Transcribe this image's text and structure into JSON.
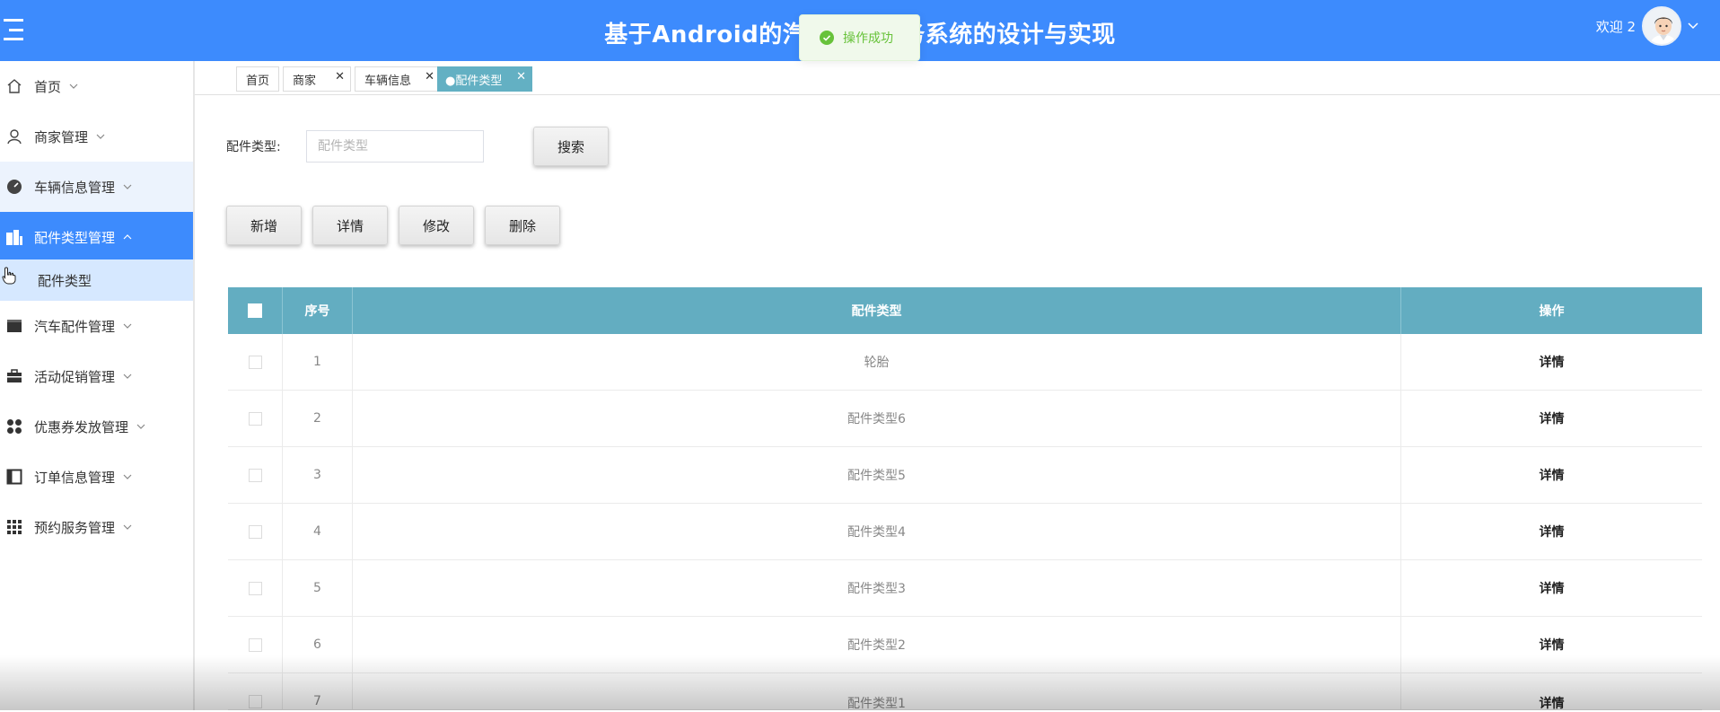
{
  "header": {
    "title": "基于Android的汽车配件服务系统的设计与实现",
    "welcome": "欢迎 2",
    "colors": {
      "primary": "#3d8bfd"
    }
  },
  "toast": {
    "text": "操作成功",
    "icon": "check-circle-icon",
    "color": "#67c23a"
  },
  "sidebar": {
    "items": [
      {
        "label": "首页",
        "icon": "home-icon"
      },
      {
        "label": "商家管理",
        "icon": "user-icon"
      },
      {
        "label": "车辆信息管理",
        "icon": "dashboard-icon"
      },
      {
        "label": "配件类型管理",
        "icon": "building-icon"
      },
      {
        "label": "汽车配件管理",
        "icon": "card-icon"
      },
      {
        "label": "活动促销管理",
        "icon": "briefcase-icon"
      },
      {
        "label": "优惠券发放管理",
        "icon": "grid-circles-icon"
      },
      {
        "label": "订单信息管理",
        "icon": "panel-icon"
      },
      {
        "label": "预约服务管理",
        "icon": "apps-icon"
      }
    ],
    "sub_item": "配件类型"
  },
  "tabs": [
    {
      "label": "首页"
    },
    {
      "label": "商家"
    },
    {
      "label": "车辆信息"
    },
    {
      "label": "●配件类型"
    }
  ],
  "search": {
    "label": "配件类型:",
    "placeholder": "配件类型",
    "button": "搜索"
  },
  "toolbar": {
    "add": "新增",
    "detail": "详情",
    "edit": "修改",
    "delete": "删除"
  },
  "table": {
    "columns": [
      "序号",
      "配件类型",
      "操作"
    ],
    "rows": [
      {
        "index": "1",
        "type": "轮胎",
        "action": "详情"
      },
      {
        "index": "2",
        "type": "配件类型6",
        "action": "详情"
      },
      {
        "index": "3",
        "type": "配件类型5",
        "action": "详情"
      },
      {
        "index": "4",
        "type": "配件类型4",
        "action": "详情"
      },
      {
        "index": "5",
        "type": "配件类型3",
        "action": "详情"
      },
      {
        "index": "6",
        "type": "配件类型2",
        "action": "详情"
      },
      {
        "index": "7",
        "type": "配件类型1",
        "action": "详情"
      }
    ]
  }
}
